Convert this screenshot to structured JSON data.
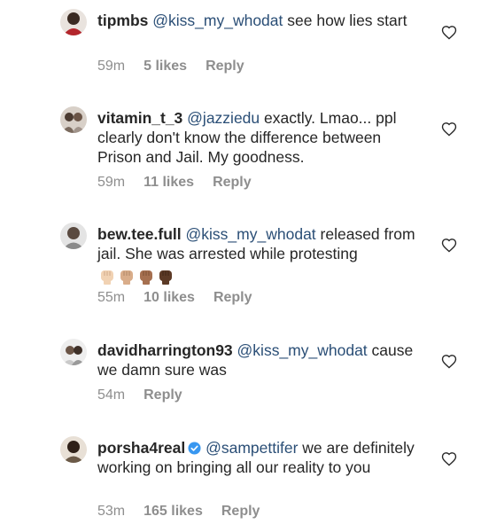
{
  "comments": [
    {
      "username": "tipmbs",
      "mention": "@kiss_my_whodat",
      "text": " see how lies start",
      "time": "59m",
      "likes": "5 likes",
      "reply": "Reply",
      "avatar_color": "#b3262c"
    },
    {
      "username": "vitamin_t_3",
      "mention": "@jazziedu",
      "text": " exactly. Lmao... ppl clearly don't know the difference between Prison and Jail. My goodness.",
      "time": "59m",
      "likes": "11 likes",
      "reply": "Reply",
      "avatar_color": "#7a6a5e"
    },
    {
      "username": "bew.tee.full",
      "mention": "@kiss_my_whodat",
      "text": " released from jail. She was arrested while protesting",
      "emoji_fists": [
        "#f1d2b3",
        "#d9ad8a",
        "#a67050",
        "#5c3a26"
      ],
      "time": "55m",
      "likes": "10 likes",
      "reply": "Reply",
      "avatar_color": "#8a8a8a"
    },
    {
      "username": "davidharrington93",
      "mention": "@kiss_my_whodat",
      "text": " cause we damn sure was",
      "time": "54m",
      "likes": "",
      "reply": "Reply",
      "avatar_color": "#c9c9c9"
    },
    {
      "username": "porsha4real",
      "verified": true,
      "mention": "@sampettifer",
      "text": " we are definitely working on bringing all our reality to you",
      "time": "53m",
      "likes": "165 likes",
      "reply": "Reply",
      "avatar_color": "#6b5a48"
    }
  ],
  "icons": {
    "like": "heart-outline-icon",
    "verified": "verified-badge-icon",
    "fist": "raised-fist-emoji"
  },
  "colors": {
    "text": "#262626",
    "mention": "#2a4e76",
    "meta": "#8e8e8e",
    "verified": "#3897f0"
  }
}
